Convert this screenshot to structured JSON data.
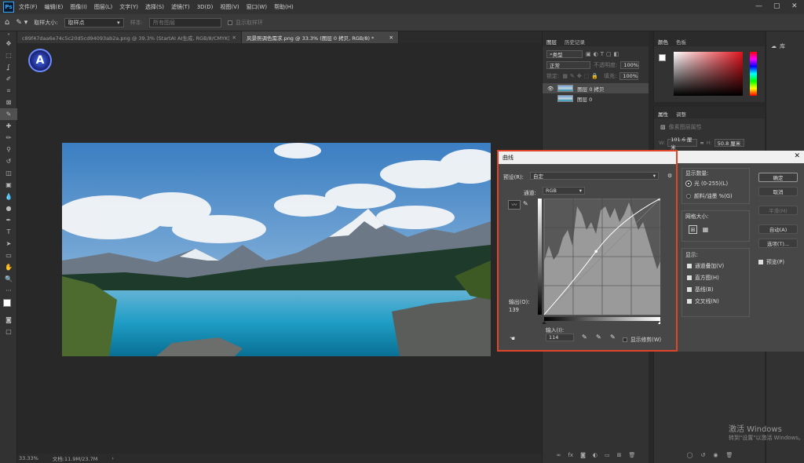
{
  "menubar": {
    "logo": "Ps",
    "items": [
      "文件(F)",
      "编辑(E)",
      "图像(I)",
      "图层(L)",
      "文字(Y)",
      "选择(S)",
      "滤镜(T)",
      "3D(D)",
      "视图(V)",
      "窗口(W)",
      "帮助(H)"
    ],
    "minimize": "—",
    "maximize": "▢",
    "close": "✕"
  },
  "options": {
    "sample_size_label": "取样大小:",
    "sample_size_value": "取样点",
    "sample_label": "样本:",
    "sample_value": "所有图层",
    "show_ring": "显示取样环"
  },
  "tabs": [
    {
      "label": "c89f47daa6e74c5c20d5cd94093ab2a.png @ 39.3% (StartAI AI生成, RGB/8/CMYK) *",
      "close": "✕"
    },
    {
      "label": "风景照调色需求.png @ 33.3% (图层 0 拷贝, RGB/8) *",
      "close": "✕"
    }
  ],
  "badge": "A",
  "status": {
    "zoom": "33.33%",
    "doc": "文档:11.9M/23.7M",
    "arrow": "›"
  },
  "layers_panel": {
    "tab_layers": "图层",
    "tab_history": "历史记录",
    "filter": "类型",
    "blend": "正常",
    "opacity_label": "不透明度:",
    "opacity_value": "100%",
    "lock_label": "锁定:",
    "fill_label": "填充:",
    "fill_value": "100%",
    "layers": [
      {
        "name": "图层 0 拷贝",
        "selected": true
      },
      {
        "name": "图层 0",
        "selected": false
      }
    ]
  },
  "color_panel": {
    "tab_color": "颜色",
    "tab_swatches": "色板"
  },
  "properties_panel": {
    "tab_props": "属性",
    "tab_adjust": "调整",
    "subtitle": "像素图层属性",
    "w_label": "W:",
    "w_value": "101.6 厘米",
    "h_label": "H:",
    "h_value": "50.8 厘米",
    "link": "∞"
  },
  "library_panel": {
    "label": "库"
  },
  "curves": {
    "title": "曲线",
    "close": "✕",
    "preset_label": "预设(R):",
    "preset_value": "自定",
    "channel_label": "通道:",
    "channel_value": "RGB",
    "output_label": "输出(O):",
    "output_value": "139",
    "input_label": "输入(I):",
    "input_value": "114",
    "show_clipping": "显示修剪(W)",
    "ok": "确定",
    "cancel": "取消",
    "smooth": "平滑(M)",
    "auto": "自动(A)",
    "options": "选项(T)...",
    "preview": "预览(P)",
    "show_amount": "显示数量:",
    "light": "光 (0-255)(L)",
    "pigment": "颜料/油墨 %(G)",
    "grid_size": "网格大小:",
    "show": "显示:",
    "show_items": [
      "通道叠加(V)",
      "直方图(H)",
      "基线(B)",
      "交叉线(N)"
    ],
    "curve_point": {
      "input": 114,
      "output": 139
    }
  },
  "watermark": {
    "line1": "激活 Windows",
    "line2": "转到\"设置\"以激活 Windows。"
  },
  "colors": {
    "accent": "#e0452a",
    "ps_blue": "#31a8ff"
  }
}
